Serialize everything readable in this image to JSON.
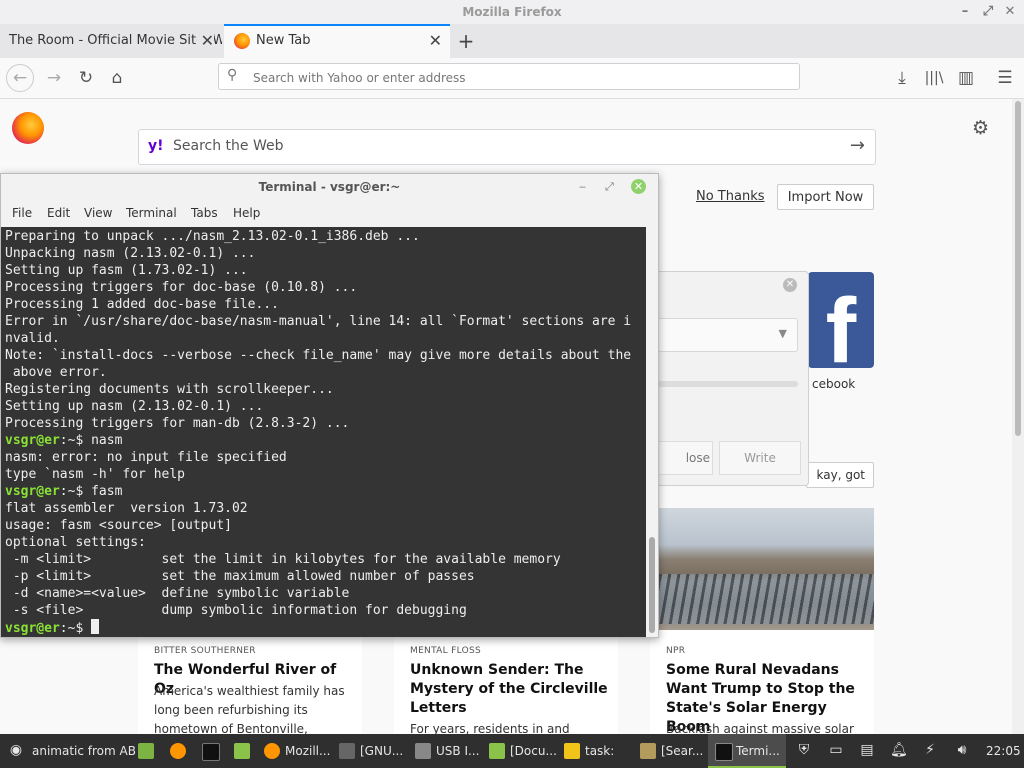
{
  "window": {
    "title": "Mozilla Firefox"
  },
  "tabs": [
    {
      "label": "The Room - Official Movie Site, Wa"
    },
    {
      "label": "New Tab"
    }
  ],
  "navbar": {
    "url_placeholder": "Search with Yahoo or enter address"
  },
  "newtab": {
    "search_placeholder": "Search the Web",
    "yahoo_logo": "y!",
    "import": {
      "no_thanks": "No Thanks",
      "import_now": "Import Now"
    },
    "topsite_label": "cebook",
    "topsite_logo": "f",
    "okay_button": "kay, got it",
    "stories": [
      {
        "source": "BITTER SOUTHERNER",
        "title": "The Wonderful River of Oz",
        "desc": "America's wealthiest family has long been refurbishing its hometown of Bentonville,"
      },
      {
        "source": "MENTAL FLOSS",
        "title": "Unknown Sender: The Mystery of the Circleville Letters",
        "desc": "For years, residents in and around"
      },
      {
        "source": "NPR",
        "title": "Some Rural Nevadans Want Trump to Stop the State's Solar Energy Boom",
        "desc": "Backlash against massive solar"
      }
    ]
  },
  "dialog": {
    "close_label": "lose",
    "write_label": "Write"
  },
  "terminal": {
    "title": "Terminal - vsgr@er:~",
    "menu": [
      "File",
      "Edit",
      "View",
      "Terminal",
      "Tabs",
      "Help"
    ],
    "prompt": "vsgr@er",
    "prompt_suffix": ":~$ ",
    "lines": [
      {
        "text": "Preparing to unpack .../nasm_2.13.02-0.1_i386.deb ..."
      },
      {
        "text": "Unpacking nasm (2.13.02-0.1) ..."
      },
      {
        "text": "Setting up fasm (1.73.02-1) ..."
      },
      {
        "text": "Processing triggers for doc-base (0.10.8) ..."
      },
      {
        "text": "Processing 1 added doc-base file..."
      },
      {
        "text": "Error in `/usr/share/doc-base/nasm-manual', line 14: all `Format' sections are i"
      },
      {
        "text": "nvalid."
      },
      {
        "text": "Note: `install-docs --verbose --check file_name' may give more details about the"
      },
      {
        "text": " above error."
      },
      {
        "text": "Registering documents with scrollkeeper..."
      },
      {
        "text": "Setting up nasm (2.13.02-0.1) ..."
      },
      {
        "text": "Processing triggers for man-db (2.8.3-2) ..."
      },
      {
        "prompt": true,
        "text": "nasm"
      },
      {
        "text": "nasm: error: no input file specified"
      },
      {
        "text": "type `nasm -h' for help"
      },
      {
        "prompt": true,
        "text": "fasm"
      },
      {
        "text": "flat assembler  version 1.73.02"
      },
      {
        "text": "usage: fasm <source> [output]"
      },
      {
        "text": "optional settings:"
      },
      {
        "text": " -m <limit>         set the limit in kilobytes for the available memory"
      },
      {
        "text": " -p <limit>         set the maximum allowed number of passes"
      },
      {
        "text": " -d <name>=<value>  define symbolic variable"
      },
      {
        "text": " -s <file>          dump symbolic information for debugging"
      },
      {
        "prompt": true,
        "text": "",
        "cursor": true
      }
    ]
  },
  "taskbar": {
    "items": [
      "animatic from AB",
      "Mozill...",
      "[GNU...",
      "USB I...",
      "[Docu...",
      "task:",
      "[Sear...",
      "Termi..."
    ],
    "clock": "22:05"
  }
}
